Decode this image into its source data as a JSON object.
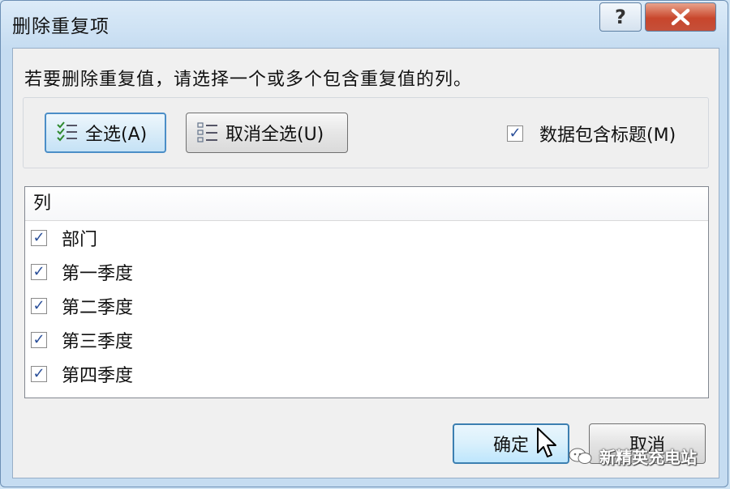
{
  "window": {
    "title": "删除重复项",
    "help_label": "?"
  },
  "prompt": "若要删除重复值，请选择一个或多个包含重复值的列。",
  "toolbar": {
    "select_all_label": "全选(A)",
    "unselect_all_label": "取消全选(U)",
    "header_checkbox": {
      "label": "数据包含标题(M)",
      "checked": true
    }
  },
  "columns": {
    "header": "列",
    "items": [
      {
        "label": "部门",
        "checked": true
      },
      {
        "label": "第一季度",
        "checked": true
      },
      {
        "label": "第二季度",
        "checked": true
      },
      {
        "label": "第三季度",
        "checked": true
      },
      {
        "label": "第四季度",
        "checked": true
      }
    ]
  },
  "footer": {
    "ok_label": "确定",
    "cancel_label": "取消"
  },
  "watermark": {
    "text": "新精英充电站",
    "icon": "wechat-icon"
  }
}
